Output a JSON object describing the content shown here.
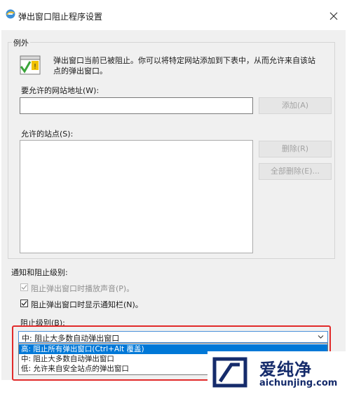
{
  "window": {
    "title": "弹出窗口阻止程序设置",
    "close_icon": "close-icon"
  },
  "exceptions": {
    "legend": "例外",
    "description_line1": "弹出窗口当前已被阻止。你可以将特定网站添加到下表中，从而允许来自该站",
    "description_line2": "点的弹出窗口。",
    "address_label": "要允许的网站地址(W):",
    "address_value": "",
    "add_button": "添加(A)",
    "allowed_label": "允许的站点(S):",
    "allowed_sites": [],
    "remove_button": "删除(R)",
    "remove_all_button": "全部删除(E)..."
  },
  "notifications": {
    "legend": "通知和阻止级别:",
    "play_sound_label": "阻止弹出窗口时播放声音(P)。",
    "play_sound_checked": true,
    "play_sound_disabled": true,
    "show_bar_label": "阻止弹出窗口时显示通知栏(N)。",
    "show_bar_checked": true,
    "level_label": "阻止级别(B):",
    "level_selected": "中: 阻止大多数自动弹出窗口",
    "level_options": [
      "高: 阻止所有弹出窗口(Ctrl+Alt 覆盖)",
      "中: 阻止大多数自动弹出窗口",
      "低: 允许来自安全站点的弹出窗口"
    ],
    "highlighted_option_index": 0
  },
  "watermark": {
    "name": "爱纯净",
    "url": "aichunjing.com"
  },
  "colors": {
    "accent": "#0078d7",
    "highlight_box": "#e12a2a",
    "watermark": "#152b6b"
  }
}
